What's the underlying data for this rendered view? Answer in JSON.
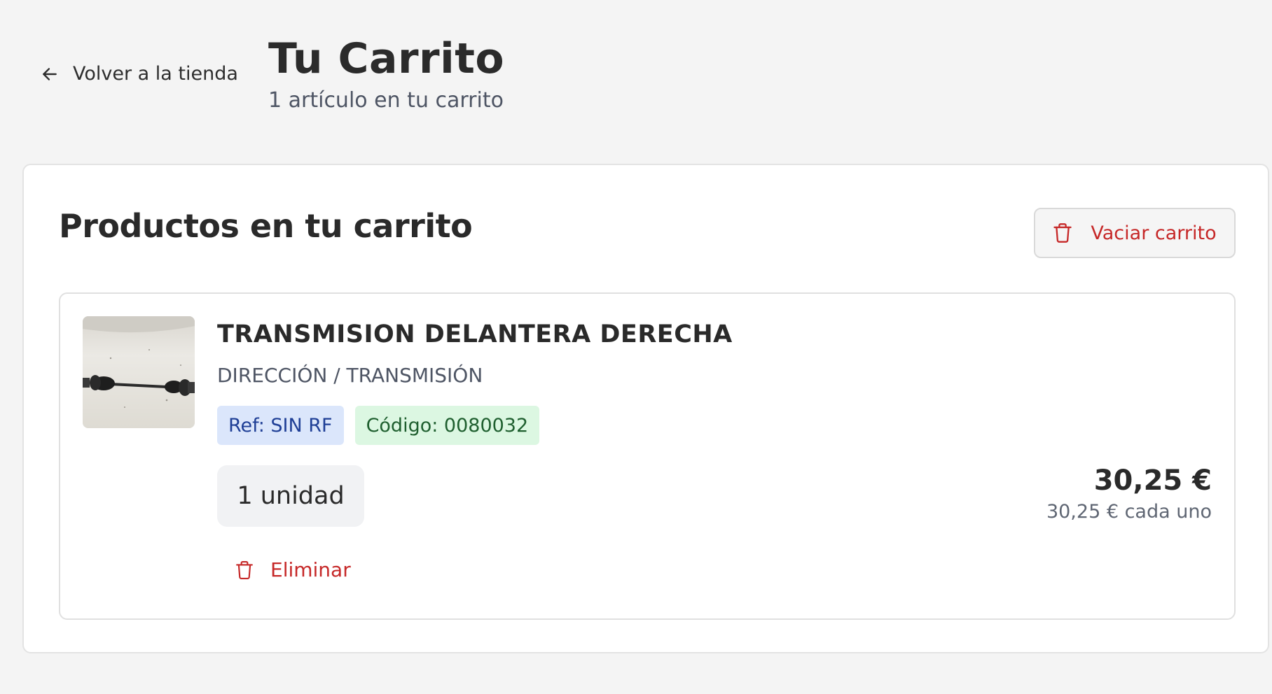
{
  "header": {
    "back_label": "Volver a la tienda",
    "title": "Tu Carrito",
    "subtitle": "1 artículo en tu carrito"
  },
  "cart": {
    "title": "Productos en tu carrito",
    "clear_label": "Vaciar carrito",
    "items": [
      {
        "name": "TRANSMISION DELANTERA DERECHA",
        "category": "DIRECCIÓN / TRANSMISIÓN",
        "ref": "Ref: SIN RF",
        "code": "Código: 0080032",
        "quantity": "1 unidad",
        "price_total": "30,25 €",
        "price_each": "30,25 € cada uno",
        "remove_label": "Eliminar",
        "image_icon": "drive-shaft-photo"
      }
    ]
  },
  "colors": {
    "background": "#f4f4f4",
    "danger": "#c62828",
    "ref_tag_bg": "#dbe6fb",
    "ref_tag_fg": "#1f3f96",
    "code_tag_bg": "#dcf7e2",
    "code_tag_fg": "#1f5f2f"
  },
  "icons": {
    "back": "arrow-left-icon",
    "trash": "trash-icon"
  }
}
